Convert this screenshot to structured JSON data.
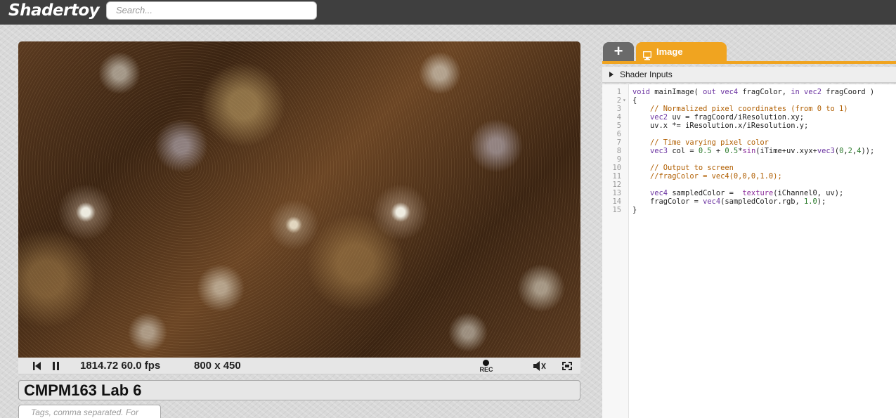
{
  "app": {
    "logo": "Shadertoy",
    "search_placeholder": "Search..."
  },
  "player": {
    "stats": "1814.72 60.0 fps",
    "resolution": "800 x 450",
    "rec_label": "REC"
  },
  "shader": {
    "title": "CMPM163 Lab 6",
    "tags_placeholder": "Tags, comma separated. For"
  },
  "editor": {
    "add_tab_label": "+",
    "tab_label": "Image",
    "shader_inputs_label": "Shader Inputs",
    "line_numbers": [
      "1",
      "2",
      "3",
      "4",
      "5",
      "6",
      "7",
      "8",
      "9",
      "10",
      "11",
      "12",
      "13",
      "14",
      "15"
    ],
    "code_lines": [
      [
        {
          "t": "void",
          "c": "kw"
        },
        {
          "t": " mainImage( ",
          "c": ""
        },
        {
          "t": "out vec4",
          "c": "kw"
        },
        {
          "t": " fragColor, ",
          "c": ""
        },
        {
          "t": "in vec2",
          "c": "kw"
        },
        {
          "t": " fragCoord )",
          "c": ""
        }
      ],
      [
        {
          "t": "{",
          "c": ""
        }
      ],
      [
        {
          "t": "    // Normalized pixel coordinates (from 0 to 1)",
          "c": "cm"
        }
      ],
      [
        {
          "t": "    ",
          "c": ""
        },
        {
          "t": "vec2",
          "c": "kw"
        },
        {
          "t": " uv = fragCoord/iResolution.xy;",
          "c": ""
        }
      ],
      [
        {
          "t": "    uv.x *= iResolution.x/iResolution.y;",
          "c": ""
        }
      ],
      [
        {
          "t": "",
          "c": ""
        }
      ],
      [
        {
          "t": "    // Time varying pixel color",
          "c": "cm"
        }
      ],
      [
        {
          "t": "    ",
          "c": ""
        },
        {
          "t": "vec3",
          "c": "kw"
        },
        {
          "t": " col = ",
          "c": ""
        },
        {
          "t": "0.5",
          "c": "num"
        },
        {
          "t": " + ",
          "c": ""
        },
        {
          "t": "0.5",
          "c": "num"
        },
        {
          "t": "*",
          "c": ""
        },
        {
          "t": "sin",
          "c": "fn"
        },
        {
          "t": "(iTime+uv.xyx+",
          "c": ""
        },
        {
          "t": "vec3",
          "c": "kw"
        },
        {
          "t": "(",
          "c": ""
        },
        {
          "t": "0",
          "c": "num"
        },
        {
          "t": ",",
          "c": ""
        },
        {
          "t": "2",
          "c": "num"
        },
        {
          "t": ",",
          "c": ""
        },
        {
          "t": "4",
          "c": "num"
        },
        {
          "t": "));",
          "c": ""
        }
      ],
      [
        {
          "t": "",
          "c": ""
        }
      ],
      [
        {
          "t": "    // Output to screen",
          "c": "cm"
        }
      ],
      [
        {
          "t": "    //fragColor = vec4(0,0,0,1.0);",
          "c": "cm"
        }
      ],
      [
        {
          "t": "",
          "c": ""
        }
      ],
      [
        {
          "t": "    ",
          "c": ""
        },
        {
          "t": "vec4",
          "c": "kw"
        },
        {
          "t": " sampledColor =  ",
          "c": ""
        },
        {
          "t": "texture",
          "c": "fn"
        },
        {
          "t": "(iChannel0, uv);",
          "c": ""
        }
      ],
      [
        {
          "t": "    fragColor = ",
          "c": ""
        },
        {
          "t": "vec4",
          "c": "kw"
        },
        {
          "t": "(sampledColor.rgb, ",
          "c": ""
        },
        {
          "t": "1.0",
          "c": "num"
        },
        {
          "t": ");",
          "c": ""
        }
      ],
      [
        {
          "t": "}",
          "c": ""
        }
      ]
    ]
  }
}
